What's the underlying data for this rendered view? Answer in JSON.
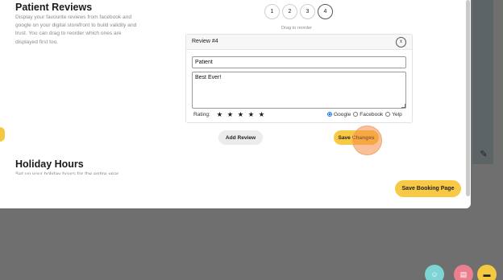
{
  "reviews_section": {
    "title": "Patient Reviews",
    "description": "Display your favourite reviews from facebook and google on your digital storefront to build validity and trust. You can drag to reorder which ones are displayed first too."
  },
  "pager": {
    "pages": [
      "1",
      "2",
      "3",
      "4"
    ],
    "active": "4",
    "hint": "Drag to reorder"
  },
  "review_card": {
    "title": "Review #4",
    "close_label": "x",
    "name_value": "Patient",
    "text_value": "Best Ever!",
    "rating_label": "Rating:",
    "stars": [
      "★",
      "★",
      "★",
      "★",
      "★"
    ],
    "rating": 5,
    "sources": [
      "Google",
      "Facebook",
      "Yelp"
    ],
    "selected_source": "Google"
  },
  "actions": {
    "add_review": "Add Review",
    "save_changes": "Save Changes",
    "save_booking": "Save Booking Page"
  },
  "holiday_section": {
    "title": "Holiday Hours",
    "description": "Set up your holiday hours for the entire year."
  },
  "floating": {
    "support_icon": "headset-icon",
    "gift_icon": "gift-card-icon",
    "chat_icon": "chat-icon"
  },
  "colors": {
    "accent": "#f7c945",
    "click_highlight": "#f58c46",
    "backdrop": "#6f6f6f"
  }
}
